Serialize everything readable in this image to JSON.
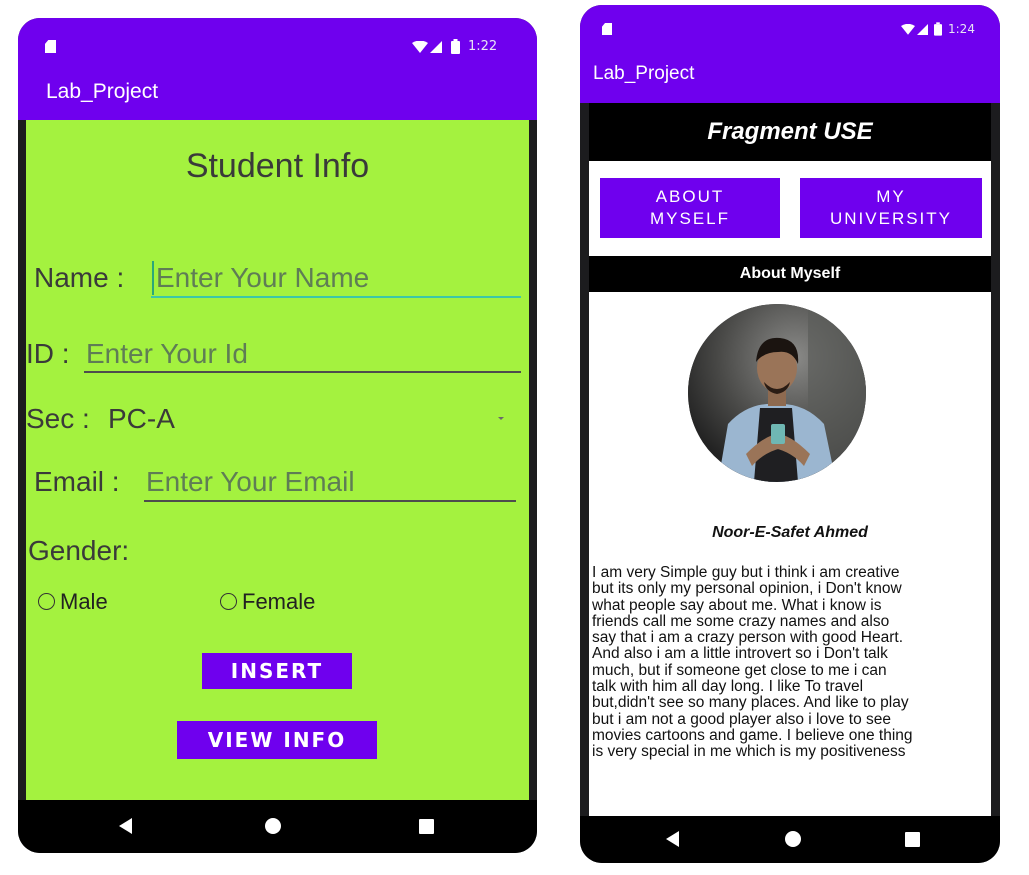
{
  "left": {
    "status": {
      "time": "1:22"
    },
    "app_title": "Lab_Project",
    "heading": "Student Info",
    "name_label": "Name :",
    "name_placeholder": "Enter Your Name",
    "id_label": "ID :",
    "id_placeholder": "Enter Your Id",
    "sec_label": "Sec :",
    "sec_value": "PC-A",
    "email_label": "Email :",
    "email_placeholder": "Enter Your Email",
    "gender_label": "Gender:",
    "gender_options": [
      "Male",
      "Female"
    ],
    "insert_label": "INSERT",
    "view_label": "VIEW INFO"
  },
  "right": {
    "status": {
      "time": "1:24"
    },
    "app_title": "Lab_Project",
    "banner": "Fragment USE",
    "buttons": {
      "about": [
        "ABOUT",
        "MYSELF"
      ],
      "university": [
        "MY",
        "UNIVERSITY"
      ]
    },
    "section_title": "About Myself",
    "profile_name": "Noor-E-Safet Ahmed",
    "about_lines": [
      "I am very Simple guy but i think i am creative",
      "but its only my personal opinion, i Don't know",
      "what people say about me. What i know is",
      "friends call me some crazy names and also",
      "say that i am a crazy person with good Heart.",
      "And also i am a little introvert so i Don't talk",
      "much, but if someone get close to me i can",
      "talk with him all day long. I like To travel",
      "but,didn't see so many places. And like to play",
      "but i am not a good player also i love to see",
      "movies cartoons and game. I believe one thing",
      "is very special in me which is my positiveness"
    ]
  },
  "colors": {
    "primary": "#6f00ee",
    "left_background": "#a4f23f",
    "accent_underline": "#3cc7a8",
    "navbar": "#000000"
  },
  "icons": [
    "sim-card-icon",
    "wifi-icon",
    "signal-icon",
    "battery-icon",
    "dropdown-arrow-icon",
    "radio-button-icon",
    "back-nav-icon",
    "home-nav-icon",
    "recent-apps-icon"
  ]
}
